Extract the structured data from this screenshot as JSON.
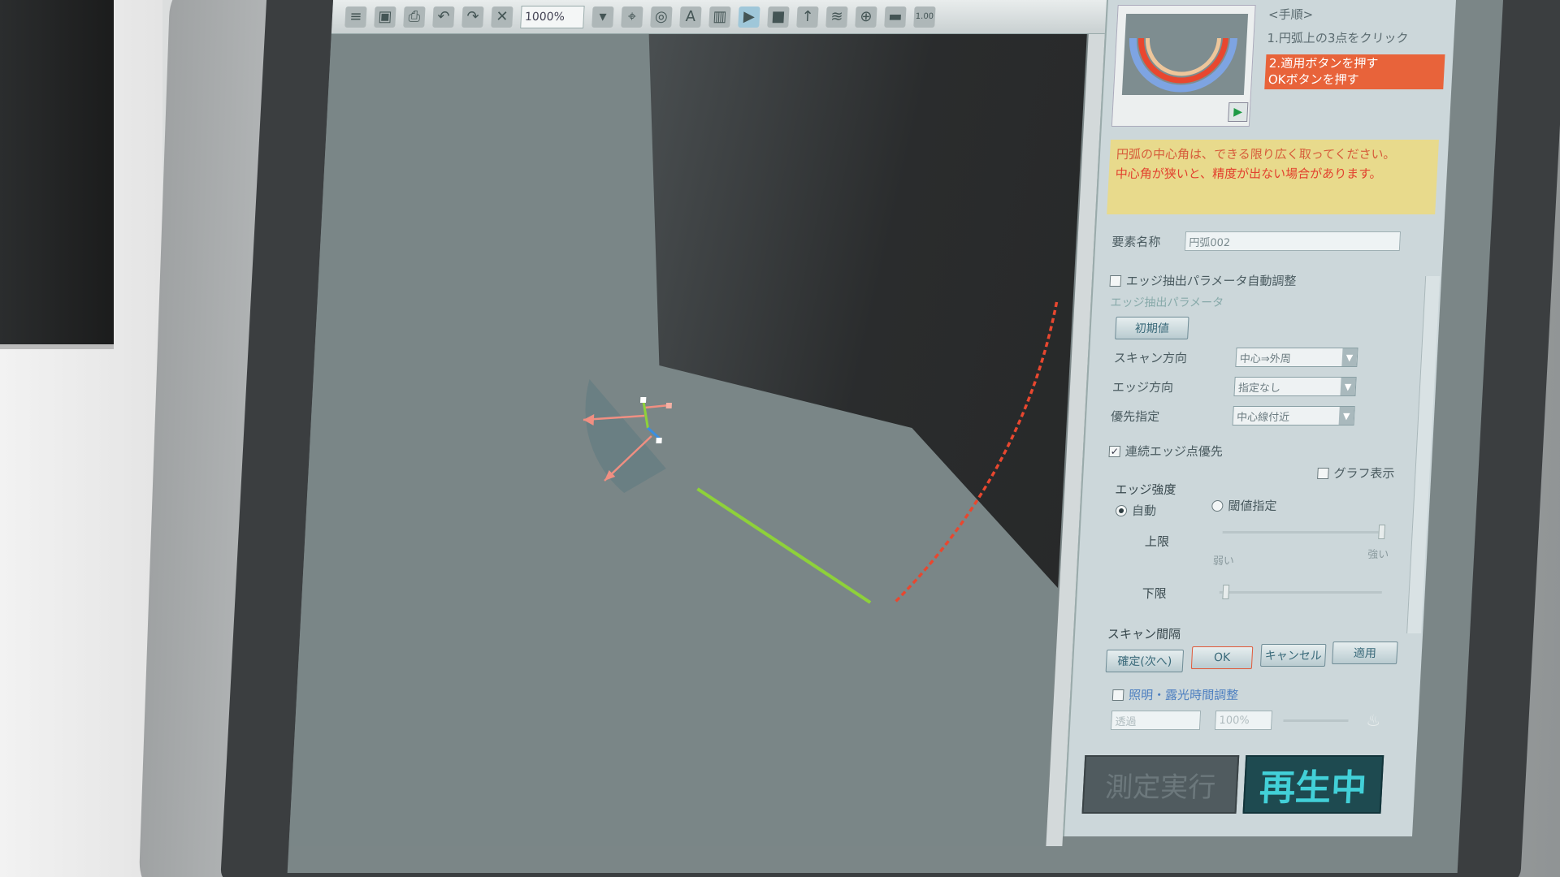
{
  "toolbar": {
    "zoom_value": "1000%",
    "scale_value": "1.00"
  },
  "panel": {
    "steps_title": "<手順>",
    "step1": "1.円弧上の3点をクリック",
    "step2_line1": "2.適用ボタンを押す",
    "step2_line2": "OKボタンを押す",
    "note_line1": "円弧の中心角は、できる限り広く取ってください。",
    "note_line2": "中心角が狭いと、精度が出ない場合があります。",
    "element_name_label": "要素名称",
    "element_name_value": "円弧002",
    "auto_adjust_label": "エッジ抽出パラメータ自動調整",
    "edge_params_section": "エッジ抽出パラメータ",
    "initial_button": "初期値",
    "scan_dir_label": "スキャン方向",
    "scan_dir_value": "中心⇒外周",
    "edge_dir_label": "エッジ方向",
    "edge_dir_value": "指定なし",
    "priority_label": "優先指定",
    "priority_value": "中心線付近",
    "continuous_label": "連続エッジ点優先",
    "graph_label": "グラフ表示",
    "edge_strength_label": "エッジ強度",
    "auto_label": "自動",
    "threshold_label": "閾値指定",
    "upper_label": "上限",
    "weak_label": "弱い",
    "strong_label": "強い",
    "lower_label": "下限",
    "scan_interval_label": "スキャン間隔",
    "confirm_button": "確定(次へ)",
    "ok_button": "OK",
    "cancel_button": "キャンセル",
    "apply_button": "適用",
    "illumination_label": "照明・露光時間調整",
    "illumination_value": "透過",
    "illumination_percent": "100%",
    "run_button": "測定実行",
    "replay_label": "再生中"
  },
  "colors": {
    "edge_arc": "#e8472f",
    "edge_line": "#8ed13a",
    "note_bg": "#e8da8c",
    "replay_text": "#42d0d8"
  },
  "icons": [
    "save-icon",
    "print-icon",
    "undo-icon",
    "redo-icon",
    "delete-icon",
    "zoom-dropdown",
    "play-icon",
    "stop-icon"
  ]
}
